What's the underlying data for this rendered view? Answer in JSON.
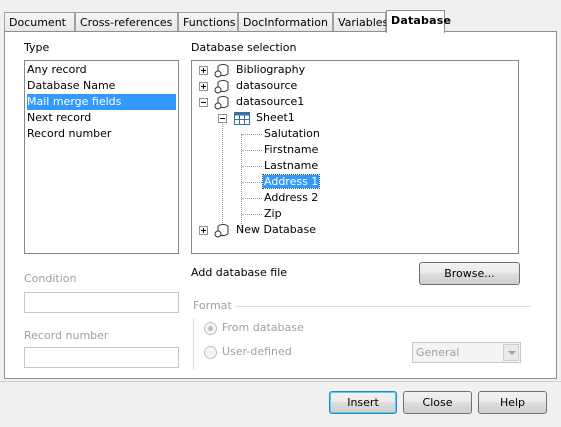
{
  "tabs": [
    {
      "label": "Document"
    },
    {
      "label": "Cross-references"
    },
    {
      "label": "Functions"
    },
    {
      "label": "DocInformation"
    },
    {
      "label": "Variables"
    },
    {
      "label": "Database",
      "active": true
    }
  ],
  "type_section": {
    "label": "Type",
    "items": [
      "Any record",
      "Database Name",
      "Mail merge fields",
      "Next record",
      "Record number"
    ],
    "selected": "Mail merge fields"
  },
  "database_selection": {
    "label": "Database selection",
    "tree": [
      {
        "label": "Bibliography",
        "icon": "database-icon",
        "expanded": false
      },
      {
        "label": "datasource",
        "icon": "database-icon",
        "expanded": false
      },
      {
        "label": "datasource1",
        "icon": "database-icon",
        "expanded": true,
        "children": [
          {
            "label": "Sheet1",
            "icon": "table-icon",
            "expanded": true,
            "fields": [
              "Salutation",
              "Firstname",
              "Lastname",
              "Address 1",
              "Address 2",
              "Zip"
            ]
          }
        ]
      },
      {
        "label": "New Database",
        "icon": "database-icon",
        "expanded": false
      }
    ],
    "selected_field": "Address 1"
  },
  "condition": {
    "label": "Condition",
    "value": ""
  },
  "record_number": {
    "label": "Record number",
    "value": ""
  },
  "add_database_file": {
    "label": "Add database file",
    "button": "Browse..."
  },
  "format": {
    "label": "Format",
    "from_database": "From database",
    "user_defined": "User-defined",
    "combo_value": "General"
  },
  "buttons": {
    "insert": "Insert",
    "close": "Close",
    "help": "Help"
  },
  "colors": {
    "selection": "#3399ff",
    "default_button_border": "#3c7fb1"
  }
}
